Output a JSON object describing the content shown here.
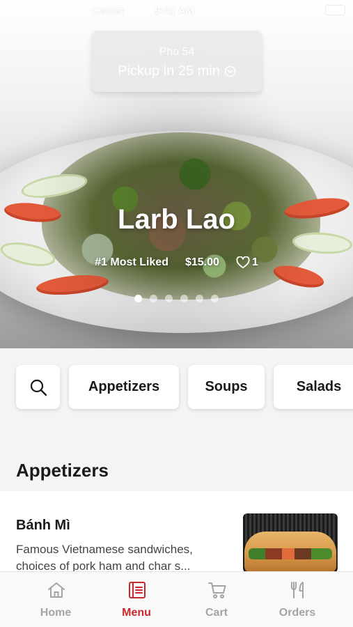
{
  "status_bar": {
    "carrier": "Carrier",
    "time": "9:41 AM"
  },
  "store": {
    "name": "Pho 54",
    "pickup": "Pickup in 25 min"
  },
  "featured": {
    "name": "Larb Lao",
    "badge": "#1 Most Liked",
    "price": "$15.00",
    "likes": "1",
    "slide_count": 6,
    "active_slide": 1
  },
  "categories": {
    "items": [
      "Appetizers",
      "Soups",
      "Salads"
    ]
  },
  "section": {
    "title": "Appetizers"
  },
  "menu_items": [
    {
      "name": "Bánh Mì",
      "description": "Famous Vietnamese sandwiches, choices of pork ham and char s..."
    }
  ],
  "tabs": {
    "home": "Home",
    "menu": "Menu",
    "cart": "Cart",
    "orders": "Orders",
    "active": "menu"
  },
  "colors": {
    "accent": "#c8282d",
    "inactive_tab": "#a4a4a4",
    "background": "#f4f4f4"
  }
}
